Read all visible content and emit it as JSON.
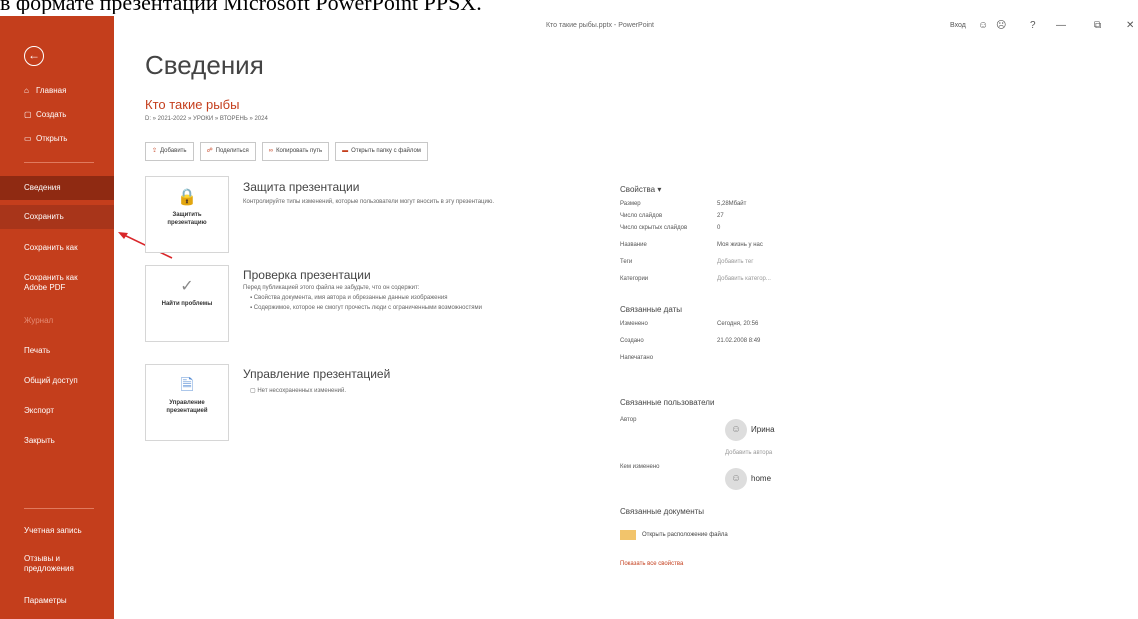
{
  "caption": "в формате презентации Microsoft PowerPoint PPSX.",
  "window": {
    "title": "Кто такие рыбы.pptx - PowerPoint",
    "signin": "Вход",
    "controls": [
      "☺",
      "☹",
      "?",
      "—",
      "⧉",
      "✕"
    ]
  },
  "sidebar": {
    "back_icon": "arrow-left-icon",
    "top_items": [
      {
        "icon": "home-icon",
        "label": "Главная"
      },
      {
        "icon": "new-icon",
        "label": "Создать"
      },
      {
        "icon": "open-icon",
        "label": "Открыть"
      }
    ],
    "items": [
      {
        "label": "Сведения",
        "state": "active"
      },
      {
        "label": "Сохранить",
        "state": "hover"
      },
      {
        "label": "Сохранить как",
        "state": ""
      },
      {
        "label": "Сохранить как Adobe PDF",
        "state": ""
      },
      {
        "label": "Журнал",
        "state": "disabled"
      },
      {
        "label": "Печать",
        "state": ""
      },
      {
        "label": "Общий доступ",
        "state": ""
      },
      {
        "label": "Экспорт",
        "state": ""
      },
      {
        "label": "Закрыть",
        "state": ""
      }
    ],
    "bottom_items": [
      {
        "label": "Учетная запись"
      },
      {
        "label": "Отзывы и предложения"
      },
      {
        "label": "Параметры"
      }
    ]
  },
  "main": {
    "page_title": "Сведения",
    "doc_name": "Кто такие рыбы",
    "doc_path": "D: » 2021-2022 » УРОКИ » ВТОРЕНЬ » 2024",
    "buttons": [
      {
        "icon": "upload-icon",
        "label": "Добавить"
      },
      {
        "icon": "share-icon",
        "label": "Поделиться"
      },
      {
        "icon": "link-icon",
        "label": "Копировать путь"
      },
      {
        "icon": "folder-icon",
        "label": "Открыть папку с файлом"
      }
    ],
    "sections": [
      {
        "card_label": "Защитить презентацию",
        "card_icon": "lock-icon",
        "title": "Защита презентации",
        "text": "Контролируйте типы изменений, которые пользователи могут вносить в эту презентацию."
      },
      {
        "card_label": "Найти проблемы",
        "card_icon": "check-icon",
        "title": "Проверка презентации",
        "text": "Перед публикацией этого файла не забудьте, что он содержит:",
        "bullets": [
          "Свойства документа, имя автора и обрезанные данные изображения",
          "Содержимое, которое не смогут прочесть люди с ограниченными возможностями"
        ]
      },
      {
        "card_label": "Управление презентацией",
        "card_icon": "manage-icon",
        "title": "Управление презентацией",
        "text": "Нет несохраненных изменений."
      }
    ]
  },
  "properties": {
    "title": "Свойства",
    "rows": [
      {
        "k": "Размер",
        "v": "5,28Мбайт"
      },
      {
        "k": "Число слайдов",
        "v": "27"
      },
      {
        "k": "Число скрытых слайдов",
        "v": "0"
      },
      {
        "k": "Название",
        "v": "Моя жизнь у нас"
      },
      {
        "k": "Теги",
        "v": "Добавить тег"
      },
      {
        "k": "Категории",
        "v": "Добавить категор..."
      }
    ],
    "dates_title": "Связанные даты",
    "dates": [
      {
        "k": "Изменено",
        "v": "Сегодня, 20:56"
      },
      {
        "k": "Создано",
        "v": "21.02.2008 8:49"
      },
      {
        "k": "Напечатано",
        "v": ""
      }
    ],
    "people_title": "Связанные пользователи",
    "author_label": "Автор",
    "author": "Ирина",
    "add_author": "Добавить автора",
    "modified_label": "Кем изменено",
    "modified_by": "home",
    "docs_title": "Связанные документы",
    "open_location": "Открыть расположение файла",
    "show_all": "Показать все свойства"
  }
}
